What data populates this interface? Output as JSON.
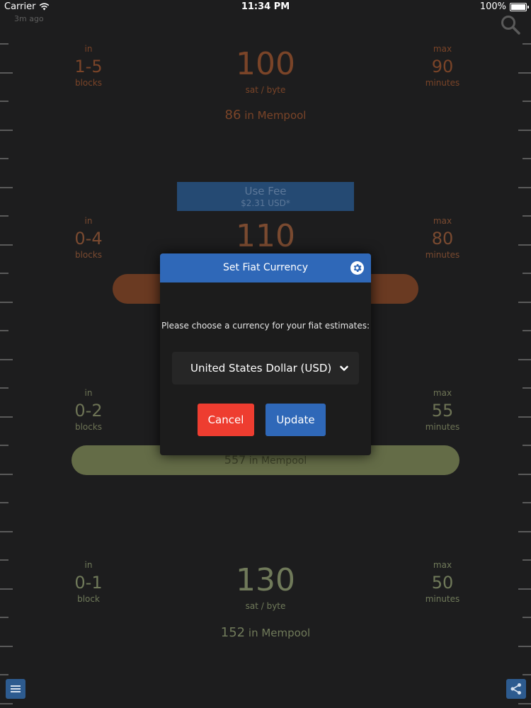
{
  "status_bar": {
    "carrier": "Carrier",
    "time": "11:34 PM",
    "battery": "100%"
  },
  "updated": "3m ago",
  "tiers": [
    {
      "in_label": "in",
      "blocks": "1-5",
      "blocks_unit": "blocks",
      "fee": "100",
      "fee_unit": "sat / byte",
      "max_label": "max",
      "minutes": "90",
      "minutes_unit": "minutes",
      "mempool_count": "86",
      "mempool_text": "in Mempool",
      "color": "#7a4428"
    },
    {
      "in_label": "in",
      "blocks": "0-4",
      "blocks_unit": "blocks",
      "fee": "110",
      "max_label": "max",
      "minutes": "80",
      "minutes_unit": "minutes",
      "color": "#7a4a30",
      "bar_color": "#6a3a22"
    },
    {
      "in_label": "in",
      "blocks": "0-2",
      "blocks_unit": "blocks",
      "max_label": "max",
      "minutes": "55",
      "minutes_unit": "minutes",
      "mempool_count": "557",
      "mempool_text": "in Mempool",
      "color": "#6d7355",
      "bar_color": "#646c47"
    },
    {
      "in_label": "in",
      "blocks": "0-1",
      "blocks_unit": "block",
      "fee": "130",
      "fee_unit": "sat / byte",
      "max_label": "max",
      "minutes": "50",
      "minutes_unit": "minutes",
      "mempool_count": "152",
      "mempool_text": "in Mempool",
      "color": "#707a5a"
    }
  ],
  "use_fee": {
    "label": "Use Fee",
    "price": "$2.31 USD*"
  },
  "modal": {
    "title": "Set Fiat Currency",
    "prompt": "Please choose a currency for your fiat estimates:",
    "selected_currency": "United States Dollar (USD)",
    "cancel_label": "Cancel",
    "update_label": "Update"
  },
  "colors": {
    "accent": "#2f68b8",
    "danger": "#ee3d30"
  }
}
